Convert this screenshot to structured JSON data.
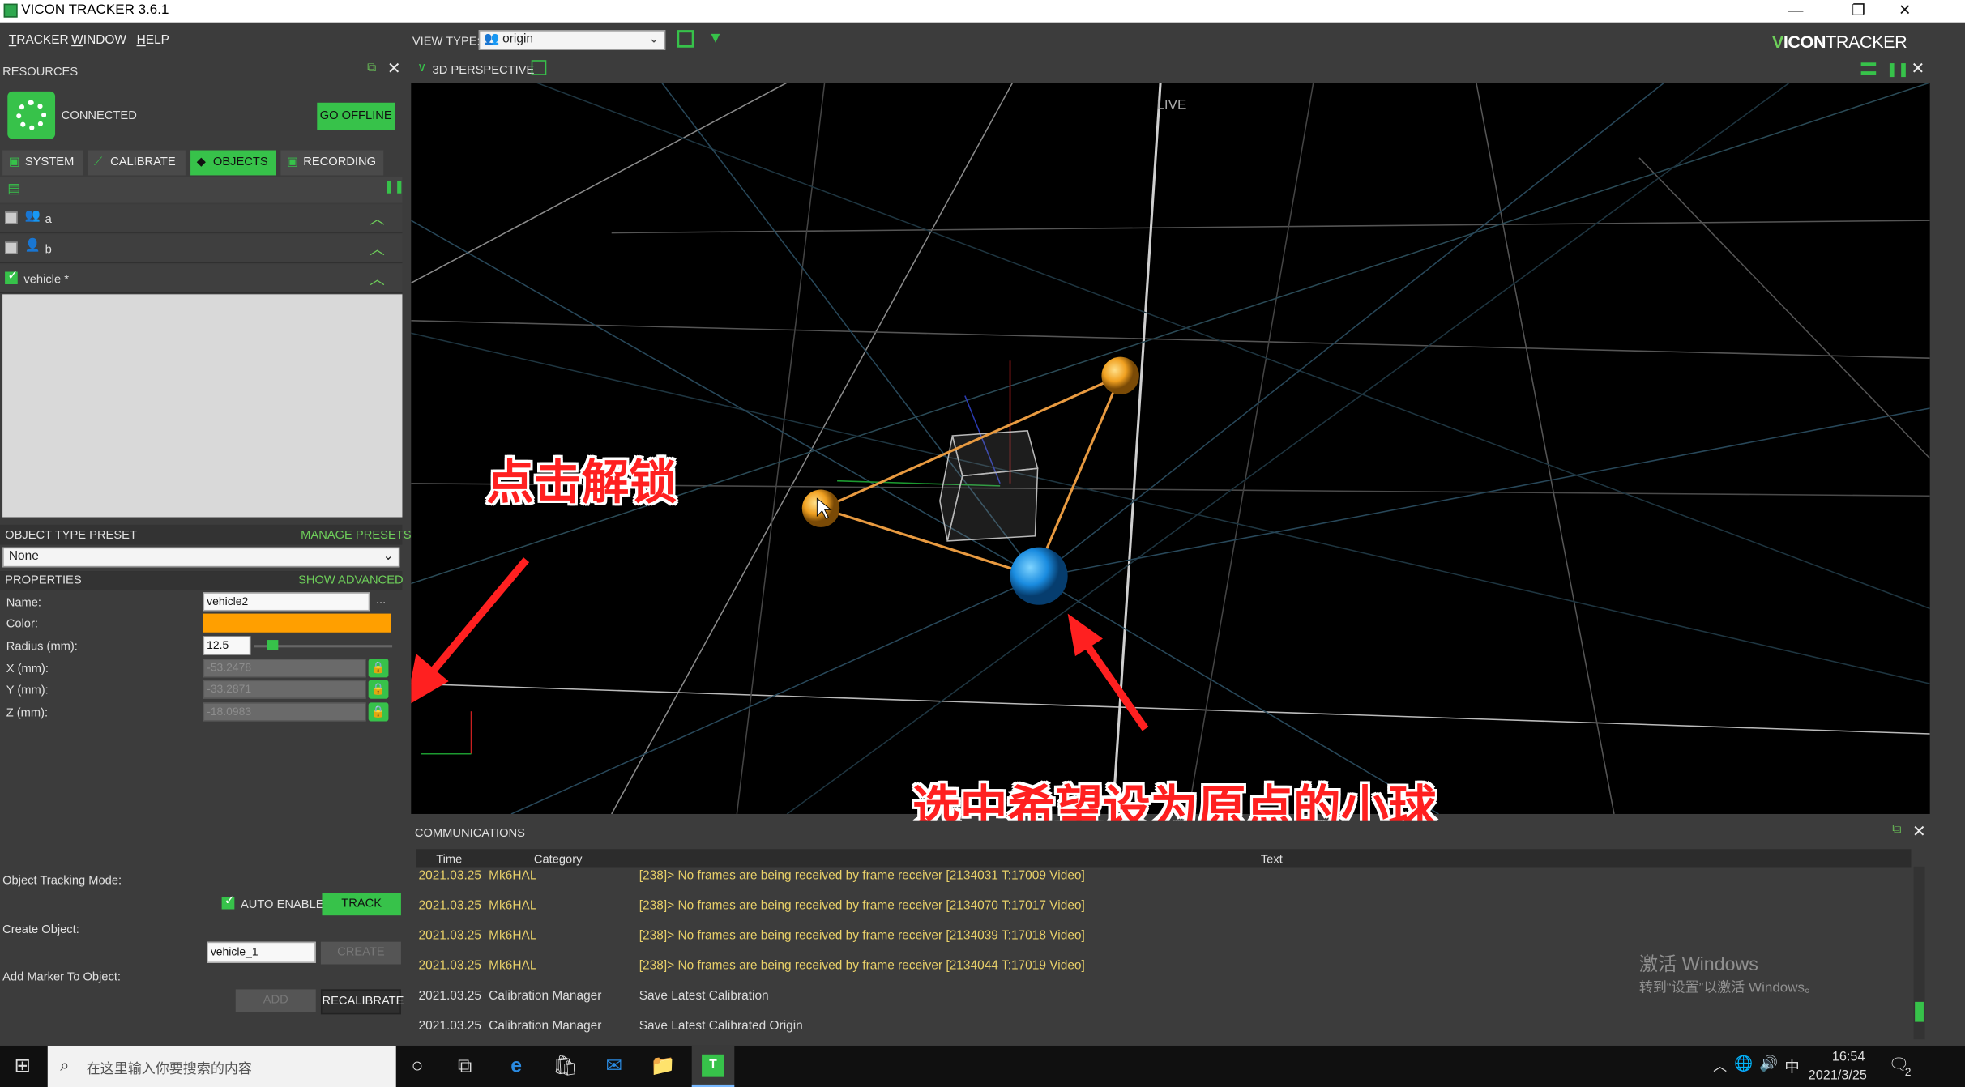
{
  "window": {
    "title": "VICON TRACKER 3.6.1",
    "minimize": "—",
    "restore": "❐",
    "close": "✕"
  },
  "menu": {
    "items": [
      "TRACKER",
      "WINDOW",
      "HELP"
    ]
  },
  "toolbar": {
    "view_type_label": "VIEW TYPE:",
    "view_type_value": "origin"
  },
  "logo": {
    "prefix": "V",
    "rest": "ICON",
    "suffix": "TRACKER"
  },
  "resources": {
    "title": "RESOURCES",
    "status": "CONNECTED",
    "go_offline": "GO OFFLINE",
    "tabs": [
      {
        "label": "SYSTEM"
      },
      {
        "label": "CALIBRATE"
      },
      {
        "label": "OBJECTS"
      },
      {
        "label": "RECORDING"
      }
    ],
    "active_tab": "OBJECTS",
    "objects": [
      {
        "name": "a",
        "checked": false
      },
      {
        "name": "b",
        "checked": false
      },
      {
        "name": "vehicle *",
        "checked": true
      }
    ]
  },
  "preset": {
    "title": "OBJECT TYPE PRESET",
    "manage": "MANAGE PRESETS",
    "value": "None"
  },
  "properties": {
    "title": "PROPERTIES",
    "show_advanced": "SHOW ADVANCED",
    "name_label": "Name:",
    "name_value": "vehicle2",
    "name_more": "...",
    "color_label": "Color:",
    "color_value": "#ff9f00",
    "radius_label": "Radius (mm):",
    "radius_value": "12.5",
    "x_label": "X (mm):",
    "x_value": "-53.2478",
    "y_label": "Y (mm):",
    "y_value": "-33.2871",
    "z_label": "Z (mm):",
    "z_value": "-18.0983"
  },
  "tracking": {
    "mode_label": "Object Tracking Mode:",
    "auto_enable": "AUTO ENABLE",
    "track": "TRACK",
    "create_label": "Create Object:",
    "create_value": "vehicle_1",
    "create_btn": "CREATE",
    "add_marker_label": "Add Marker To Object:",
    "add_btn": "ADD",
    "recalibrate": "RECALIBRATE"
  },
  "viewport": {
    "title": "3D PERSPECTIVE",
    "live": "LIVE"
  },
  "annotations": {
    "unlock": "点击解锁",
    "select": "选中希望设为原点的小球"
  },
  "communications": {
    "title": "COMMUNICATIONS",
    "columns": [
      "Time",
      "Category",
      "Text"
    ],
    "rows": [
      {
        "time": "2021.03.25",
        "category": "Mk6HAL",
        "text": "[238]> No frames are being received by frame receiver [2134031 T:17009 Video]",
        "level": "warn"
      },
      {
        "time": "2021.03.25",
        "category": "Mk6HAL",
        "text": "[238]> No frames are being received by frame receiver [2134070 T:17017 Video]",
        "level": "warn"
      },
      {
        "time": "2021.03.25",
        "category": "Mk6HAL",
        "text": "[238]> No frames are being received by frame receiver [2134039 T:17018 Video]",
        "level": "warn"
      },
      {
        "time": "2021.03.25",
        "category": "Mk6HAL",
        "text": "[238]> No frames are being received by frame receiver [2134044 T:17019 Video]",
        "level": "warn"
      },
      {
        "time": "2021.03.25",
        "category": "Calibration Manager",
        "text": "Save Latest Calibration",
        "level": "info"
      },
      {
        "time": "2021.03.25",
        "category": "Calibration Manager",
        "text": "Save Latest Calibrated Origin",
        "level": "info"
      }
    ]
  },
  "watermark": {
    "line1": "激活 Windows",
    "line2": "转到“设置”以激活 Windows。"
  },
  "taskbar": {
    "search_placeholder": "在这里输入你要搜索的内容",
    "time": "16:54",
    "date": "2021/3/25",
    "ime": "中",
    "notifications": "2"
  }
}
